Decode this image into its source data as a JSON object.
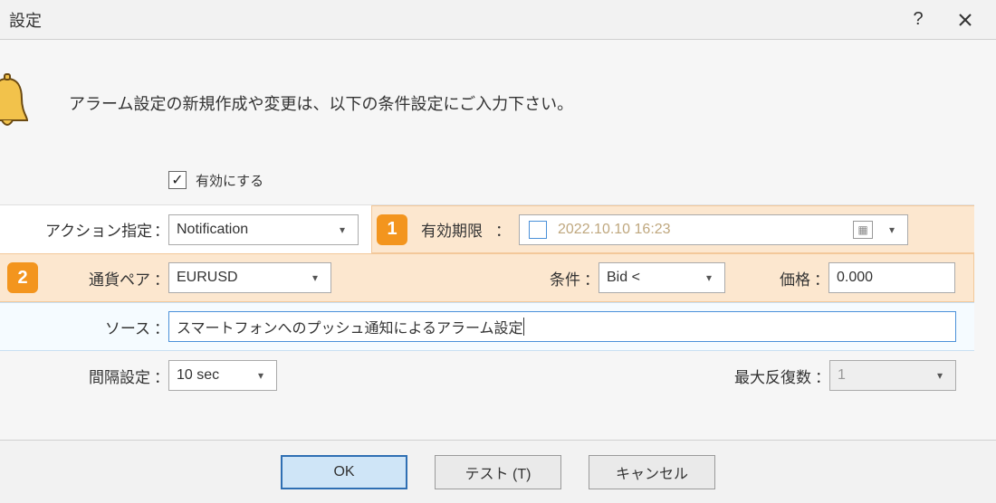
{
  "title": "設定",
  "intro": "アラーム設定の新規作成や変更は、以下の条件設定にご入力下さい。",
  "enable": {
    "label": "有効にする",
    "checked": true
  },
  "row_action": {
    "label": "アクション指定",
    "value": "Notification",
    "badge": "1",
    "expiry_label": "有効期限",
    "expiry_checked": false,
    "expiry_value": "2022.10.10 16:23"
  },
  "row_symbol": {
    "badge": "2",
    "label": "通貨ペア",
    "value": "EURUSD",
    "cond_label": "条件",
    "cond_value": "Bid <",
    "price_label": "価格",
    "price_value": "0.000"
  },
  "row_source": {
    "label": "ソース",
    "value": "スマートフォンへのプッシュ通知によるアラーム設定"
  },
  "row_interval": {
    "label": "間隔設定",
    "value": "10 sec",
    "repeat_label": "最大反復数",
    "repeat_value": "1"
  },
  "buttons": {
    "ok": "OK",
    "test": "テスト (T)",
    "cancel": "キャンセル"
  }
}
